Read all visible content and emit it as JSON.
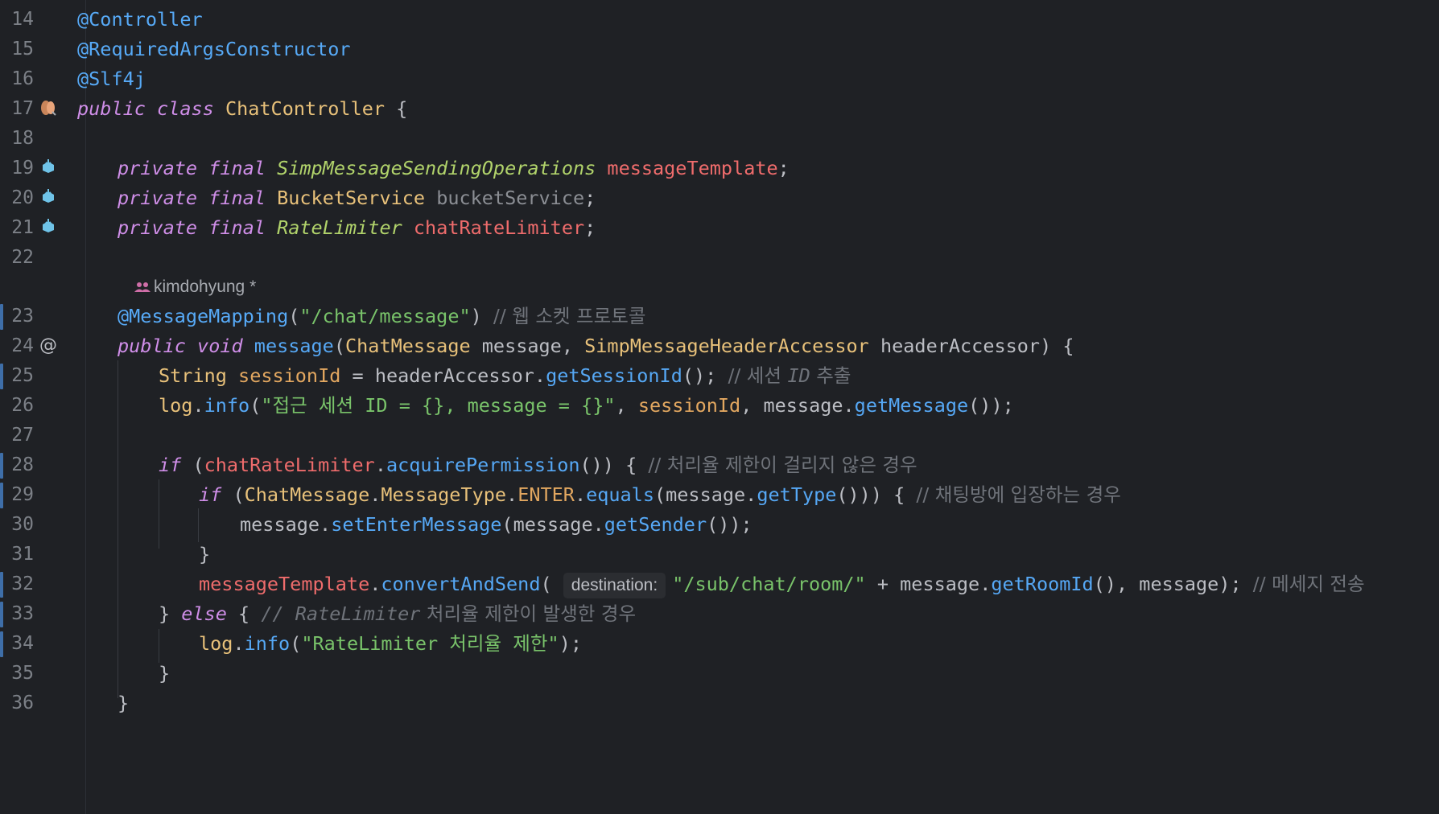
{
  "editor": {
    "author_hint": "kimdohyung *",
    "lines": [
      {
        "n": "14"
      },
      {
        "n": "15"
      },
      {
        "n": "16"
      },
      {
        "n": "17"
      },
      {
        "n": "18"
      },
      {
        "n": "19"
      },
      {
        "n": "20"
      },
      {
        "n": "21"
      },
      {
        "n": "22"
      },
      {
        "n": "23"
      },
      {
        "n": "24"
      },
      {
        "n": "25"
      },
      {
        "n": "26"
      },
      {
        "n": "27"
      },
      {
        "n": "28"
      },
      {
        "n": "29"
      },
      {
        "n": "30"
      },
      {
        "n": "31"
      },
      {
        "n": "32"
      },
      {
        "n": "33"
      },
      {
        "n": "34"
      },
      {
        "n": "35"
      },
      {
        "n": "36"
      }
    ],
    "code": {
      "l14": [
        "@Controller"
      ],
      "l15": [
        "@RequiredArgsConstructor"
      ],
      "l16": [
        "@Slf4j"
      ],
      "l17": [
        "public",
        " ",
        "class",
        " ",
        "ChatController",
        " {"
      ],
      "l19": [
        "private",
        " ",
        "final",
        " ",
        "SimpMessageSendingOperations",
        " ",
        "messageTemplate",
        ";"
      ],
      "l20": [
        "private",
        " ",
        "final",
        " ",
        "BucketService",
        " ",
        "bucketService",
        ";"
      ],
      "l21": [
        "private",
        " ",
        "final",
        " ",
        "RateLimiter",
        " ",
        "chatRateLimiter",
        ";"
      ],
      "l23": [
        "@MessageMapping",
        "(",
        "\"/chat/message\"",
        ") ",
        "// 웹 소켓 프로토콜"
      ],
      "l24": [
        "public",
        " ",
        "void",
        " ",
        "message",
        "(",
        "ChatMessage",
        " message, ",
        "SimpMessageHeaderAccessor",
        " headerAccessor) {"
      ],
      "l25": [
        "String",
        " ",
        "sessionId",
        " = headerAccessor.",
        "getSessionId",
        "(); ",
        "// 세션 ",
        "ID",
        " 추출"
      ],
      "l26": [
        "log",
        ".",
        "info",
        "(",
        "\"접근 세션 ID = {}, message = {}\"",
        ", ",
        "sessionId",
        ", message.",
        "getMessage",
        "());"
      ],
      "l28": [
        "if",
        " (",
        "chatRateLimiter",
        ".",
        "acquirePermission",
        "()) { ",
        "// 처리율 제한이 걸리지 않은 경우"
      ],
      "l29": [
        "if",
        " (",
        "ChatMessage",
        ".",
        "MessageType",
        ".",
        "ENTER",
        ".",
        "equals",
        "(message.",
        "getType",
        "())) { ",
        "// 채팅방에 입장하는 경우"
      ],
      "l30": [
        "message.",
        "setEnterMessage",
        "(message.",
        "getSender",
        "());"
      ],
      "l31": [
        "}"
      ],
      "l32": [
        "messageTemplate",
        ".",
        "convertAndSend",
        "( ",
        "destination:",
        "\"/sub/chat/room/\"",
        " + message.",
        "getRoomId",
        "(), message); ",
        "// 메세지 전송"
      ],
      "l33": [
        "} ",
        "else",
        " { ",
        "// RateLimiter",
        " 처리율 제한이 발생한 경우"
      ],
      "l34": [
        "log",
        ".",
        "info",
        "(",
        "\"RateLimiter 처리율 제한\"",
        ");"
      ],
      "l35": [
        "}"
      ],
      "l36": [
        "}"
      ]
    }
  },
  "colors": {
    "background": "#1f2125",
    "keyword": "#cf8ee8",
    "annotation": "#57aaf7",
    "string": "#79c36a",
    "field": "#ef6c6c",
    "comment": "#6f737a",
    "change_marker": "#3e6ea8"
  },
  "icons": {
    "l17": "bean-class-icon",
    "l19": "injected-bean-icon",
    "l20": "injected-bean-icon",
    "l21": "injected-bean-icon",
    "l24": "websocket-mapping-icon"
  }
}
